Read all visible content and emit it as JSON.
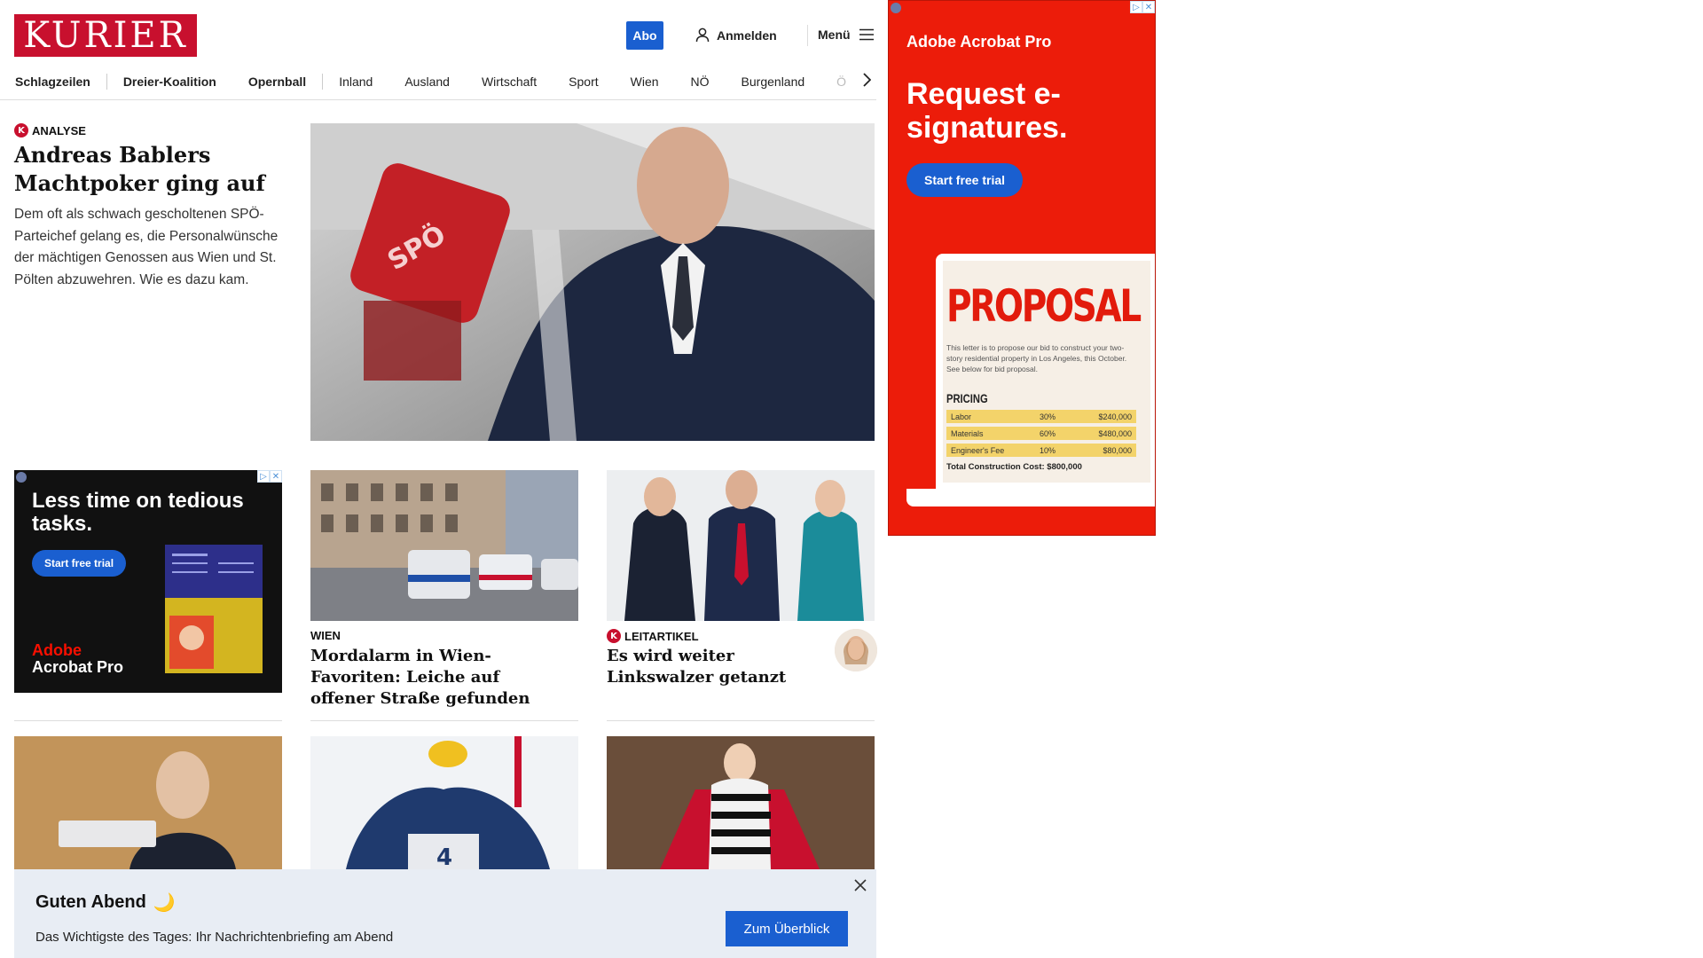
{
  "header": {
    "logo_text": "KURIER",
    "abo_label": "Abo",
    "login_label": "Anmelden",
    "menu_label": "Menü"
  },
  "nav": {
    "items": [
      "Schlagzeilen",
      "Dreier-Koalition",
      "Opernball",
      "Inland",
      "Ausland",
      "Wirtschaft",
      "Sport",
      "Wien",
      "NÖ",
      "Burgenland",
      "Ö"
    ]
  },
  "lead": {
    "kicker": "ANALYSE",
    "title": "Andreas Bablers Machtpoker ging auf",
    "teaser": "Dem oft als schwach gescholtenen SPÖ-Parteichef gelang es, die Personalwünsche der mächtigen Genossen aus Wien und St. Pölten abzuwehren. Wie es dazu kam."
  },
  "ad_small": {
    "headline": "Less time on tedious tasks.",
    "cta": "Start free trial",
    "brand_line1": "Adobe",
    "brand_line2": "Acrobat Pro"
  },
  "cards": [
    {
      "kicker": "WIEN",
      "title": "Mordalarm in Wien-Favoriten: Leiche auf offener Straße gefunden"
    },
    {
      "kicker": "LEITARTIKEL",
      "title": "Es wird weiter Linkswalzer getanzt"
    }
  ],
  "ad_big": {
    "brand": "Adobe Acrobat Pro",
    "headline": "Request e-signatures.",
    "cta": "Start free trial",
    "doc_title": "PROPOSAL",
    "doc_body": "This letter is to propose our bid to construct your two-story residential property in Los Angeles, this October. See below for bid proposal.",
    "pricing_label": "PRICING",
    "rows": [
      {
        "item": "Labor",
        "pct": "30%",
        "amount": "$240,000"
      },
      {
        "item": "Materials",
        "pct": "60%",
        "amount": "$480,000"
      },
      {
        "item": "Engineer's Fee",
        "pct": "10%",
        "amount": "$80,000"
      }
    ],
    "total": "Total Construction Cost: $800,000"
  },
  "briefing": {
    "greeting": "Guten Abend",
    "greeting_emoji": "🌙",
    "subtitle": "Das Wichtigste des Tages: Ihr Nachrichtenbriefing am Abend",
    "cta": "Zum Überblick"
  },
  "colors": {
    "brand_red": "#c8102e",
    "button_blue": "#1a5fd0",
    "banner_bg": "#e8edf4",
    "ad_red": "#ec1c0a"
  }
}
